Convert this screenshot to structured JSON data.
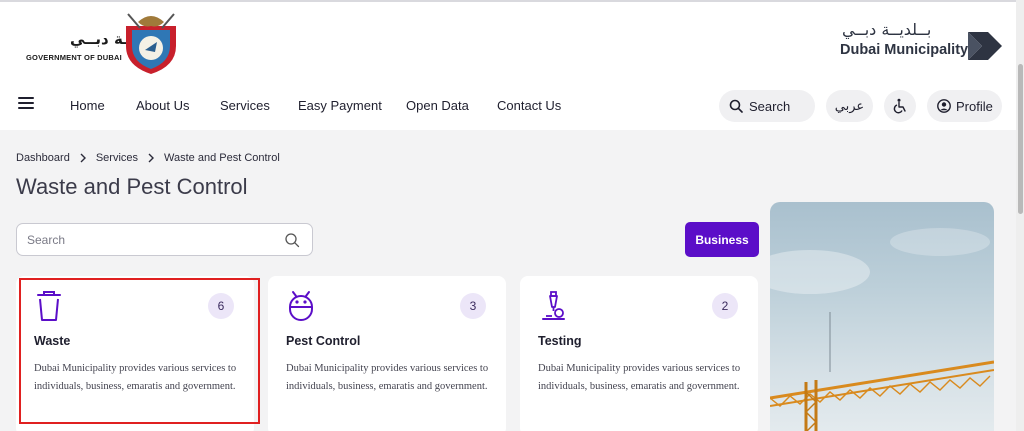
{
  "header": {
    "gov_logo_ar": "حكومـة دبــي",
    "gov_logo_en": "GOVERNMENT OF DUBAI",
    "dm_logo_ar": "بــلديــة دبــي",
    "dm_logo_en": "Dubai Municipality",
    "brand_color": "#5b0ec8"
  },
  "nav": {
    "menu_icon": "hamburger-icon",
    "links": [
      "Home",
      "About Us",
      "Services",
      "Easy Payment",
      "Open Data",
      "Contact Us"
    ],
    "search_label": "Search",
    "language_label": "عربي",
    "accessibility_icon": "wheelchair-icon",
    "profile_label": "Profile"
  },
  "breadcrumb": [
    "Dashboard",
    "Services",
    "Waste and Pest Control"
  ],
  "page_title": "Waste and Pest Control",
  "search": {
    "placeholder": "Search"
  },
  "business_button": "Business",
  "cards": [
    {
      "icon": "trash-bin-icon",
      "title": "Waste",
      "count": "6",
      "description": "Dubai Municipality provides various services to individuals, business, emaratis and government.",
      "selected": true
    },
    {
      "icon": "bug-icon",
      "title": "Pest Control",
      "count": "3",
      "description": "Dubai Municipality provides various services to individuals, business, emaratis and government.",
      "selected": false
    },
    {
      "icon": "microscope-icon",
      "title": "Testing",
      "count": "2",
      "description": "Dubai Municipality provides various services to individuals, business, emaratis and government.",
      "selected": false
    }
  ]
}
